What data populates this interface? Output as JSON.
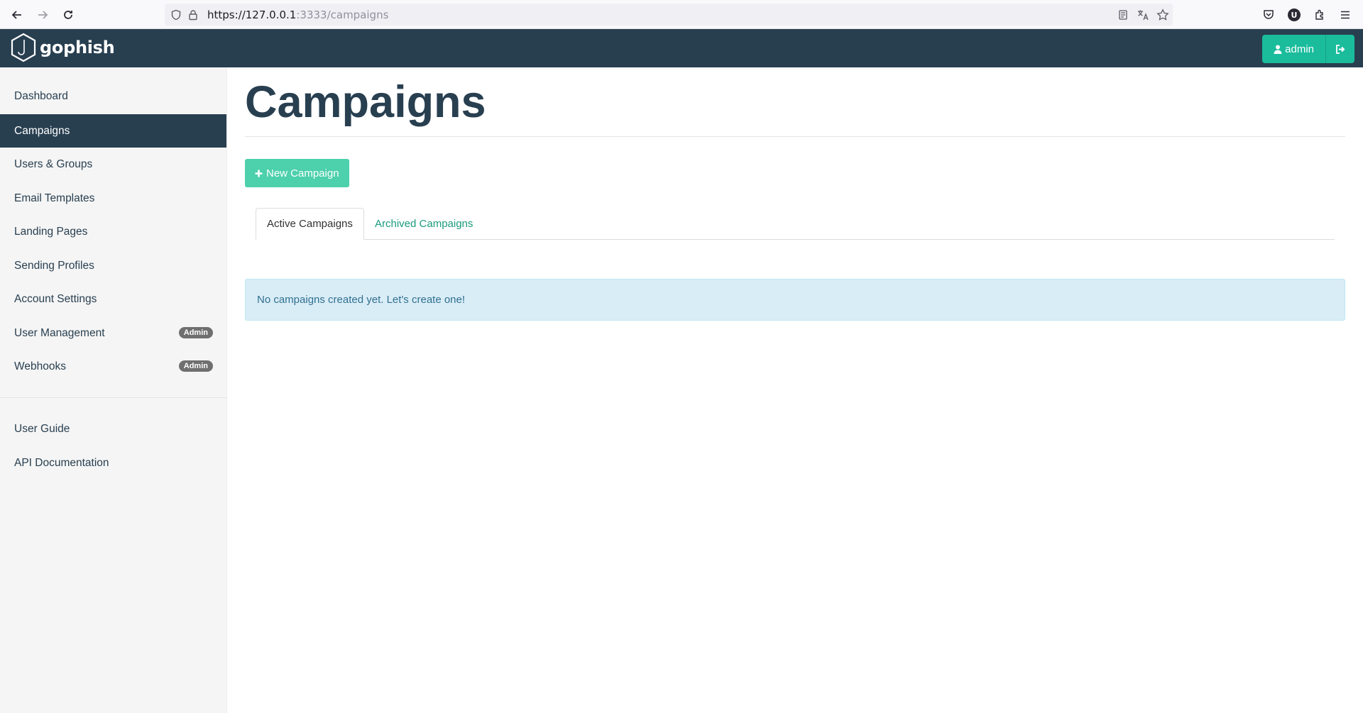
{
  "browser": {
    "url_host": "https://127.0.0.1",
    "url_rest": ":3333/campaigns"
  },
  "navbar": {
    "brand": "gophish",
    "user_label": "admin",
    "bg_color": "#283f50",
    "accent_color": "#1abc9c"
  },
  "sidebar": {
    "items": [
      {
        "label": "Dashboard"
      },
      {
        "label": "Campaigns",
        "active": true
      },
      {
        "label": "Users & Groups"
      },
      {
        "label": "Email Templates"
      },
      {
        "label": "Landing Pages"
      },
      {
        "label": "Sending Profiles"
      },
      {
        "label": "Account Settings"
      },
      {
        "label": "User Management",
        "badge": "Admin"
      },
      {
        "label": "Webhooks",
        "badge": "Admin"
      }
    ],
    "secondary": [
      {
        "label": "User Guide"
      },
      {
        "label": "API Documentation"
      }
    ]
  },
  "main": {
    "title": "Campaigns",
    "new_button": "New Campaign",
    "tabs": [
      {
        "label": "Active Campaigns",
        "active": true
      },
      {
        "label": "Archived Campaigns"
      }
    ],
    "empty_message": "No campaigns created yet. Let's create one!"
  }
}
